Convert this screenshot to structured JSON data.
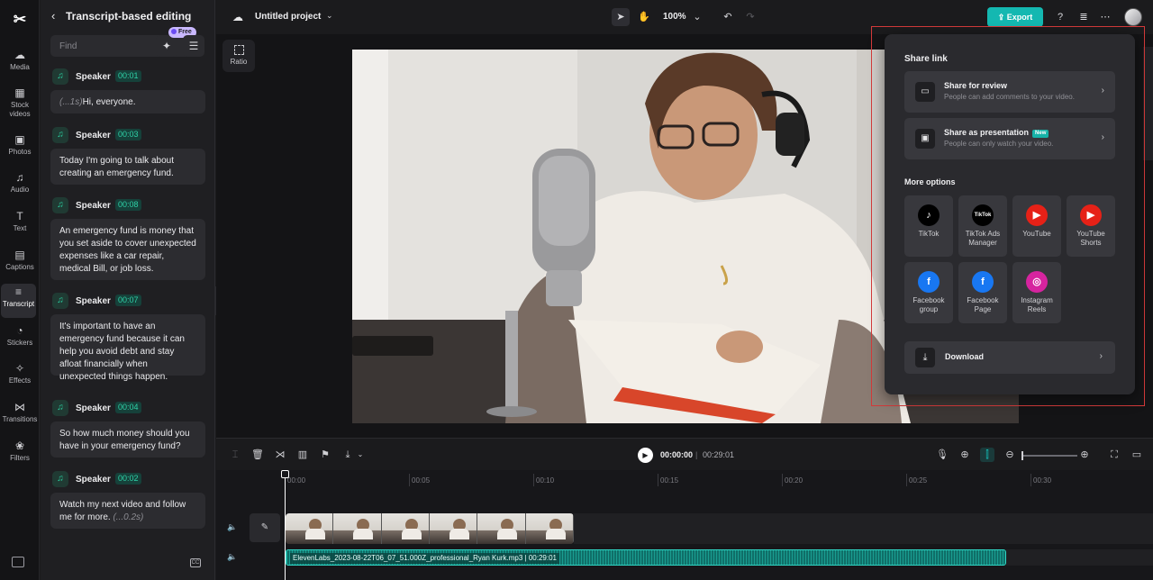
{
  "rail": {
    "items": [
      {
        "label": "Media",
        "icon": "cloud-upload-icon",
        "glyph": "☁"
      },
      {
        "label": "Stock videos",
        "icon": "film-icon",
        "glyph": "▦"
      },
      {
        "label": "Photos",
        "icon": "image-icon",
        "glyph": "▣"
      },
      {
        "label": "Audio",
        "icon": "music-note-icon",
        "glyph": "♫"
      },
      {
        "label": "Text",
        "icon": "text-icon",
        "glyph": "T"
      },
      {
        "label": "Captions",
        "icon": "captions-icon",
        "glyph": "▤"
      },
      {
        "label": "Transcript",
        "icon": "transcript-icon",
        "glyph": "≡"
      },
      {
        "label": "Stickers",
        "icon": "sticker-icon",
        "glyph": "◔"
      },
      {
        "label": "Effects",
        "icon": "sparkle-icon",
        "glyph": "✧"
      },
      {
        "label": "Transitions",
        "icon": "transition-icon",
        "glyph": "⋈"
      },
      {
        "label": "Filters",
        "icon": "filter-icon",
        "glyph": "❀"
      }
    ],
    "active": "Transcript"
  },
  "transcript": {
    "title": "Transcript-based editing",
    "find_placeholder": "Find",
    "free_badge": "Free",
    "segments": [
      {
        "speaker": "Speaker",
        "time": "00:01",
        "pause": "(...1s)",
        "text": "Hi, everyone.",
        "pause_after": ""
      },
      {
        "speaker": "Speaker",
        "time": "00:03",
        "pause": "",
        "text": "Today I'm going to talk about creating an emergency fund.",
        "pause_after": ""
      },
      {
        "speaker": "Speaker",
        "time": "00:08",
        "pause": "",
        "text": "An emergency fund is money that you set aside to cover unexpected expenses like a car repair, medical Bill, or job loss.",
        "pause_after": ""
      },
      {
        "speaker": "Speaker",
        "time": "00:07",
        "pause": "",
        "text": "It's important to have an emergency fund because it can help you avoid debt and stay afloat financially when unexpected things happen.",
        "pause_after": ""
      },
      {
        "speaker": "Speaker",
        "time": "00:04",
        "pause": "",
        "text": "So how much money should you have in your emergency fund?",
        "pause_after": ""
      },
      {
        "speaker": "Speaker",
        "time": "00:02",
        "pause": "",
        "text": "Watch my next video and follow me for more.",
        "pause_after": "(...0.2s)"
      }
    ]
  },
  "topbar": {
    "project_title": "Untitled project",
    "zoom": "100%",
    "export_label": "Export"
  },
  "canvas": {
    "ratio_label": "Ratio"
  },
  "share": {
    "title": "Share link",
    "review": {
      "title": "Share for review",
      "subtitle": "People can add comments to your video."
    },
    "presentation": {
      "title": "Share as presentation",
      "badge": "New",
      "subtitle": "People can only watch your video."
    },
    "more_title": "More options",
    "tiles": [
      {
        "label": "TikTok",
        "icon": "tiktok-icon",
        "glyph": "♪",
        "color": "#000000"
      },
      {
        "label": "TikTok Ads Manager",
        "icon": "tiktok-ads-icon",
        "glyph": "TikTok",
        "color": "#000000"
      },
      {
        "label": "YouTube",
        "icon": "youtube-icon",
        "glyph": "▶",
        "color": "#e62117"
      },
      {
        "label": "YouTube Shorts",
        "icon": "youtube-shorts-icon",
        "glyph": "▶",
        "color": "#e62117"
      },
      {
        "label": "Facebook group",
        "icon": "facebook-icon",
        "glyph": "f",
        "color": "#1877f2"
      },
      {
        "label": "Facebook Page",
        "icon": "facebook-icon",
        "glyph": "f",
        "color": "#1877f2"
      },
      {
        "label": "Instagram Reels",
        "icon": "instagram-icon",
        "glyph": "◎",
        "color": "#d6249f"
      }
    ],
    "download_label": "Download"
  },
  "timeline": {
    "current_time": "00:00:00",
    "separator": "|",
    "total_time": "00:29:01",
    "ruler": [
      "00:00",
      "00:05",
      "00:10",
      "00:15",
      "00:20",
      "00:25",
      "00:30"
    ],
    "audio_clip_name": "ElevenLabs_2023-08-22T06_07_51.000Z_professional_Ryan Kurk.mp3",
    "audio_clip_duration": "00:29:01"
  },
  "colors": {
    "accent": "#14b8b1",
    "background": "#1b1b1d",
    "panel": "#1f1f22",
    "highlight_outline": "#d43a3a"
  }
}
